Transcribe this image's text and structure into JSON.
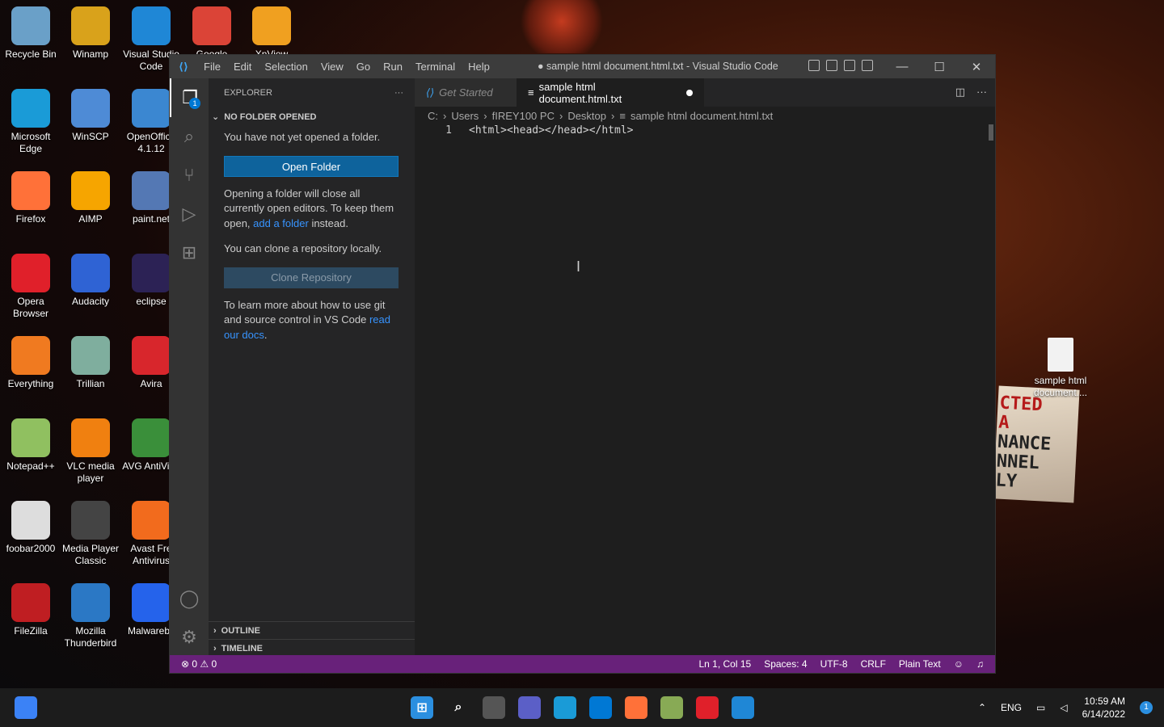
{
  "desktop": {
    "icons": [
      {
        "label": "Recycle Bin",
        "color": "#6aa0c8"
      },
      {
        "label": "Winamp",
        "color": "#d9a21b"
      },
      {
        "label": "Visual Studio Code",
        "color": "#1f87d6"
      },
      {
        "label": "Google",
        "color": "#db4437"
      },
      {
        "label": "XnView",
        "color": "#f0a020"
      },
      {
        "label": "Microsoft Edge",
        "color": "#1a9bd7"
      },
      {
        "label": "WinSCP",
        "color": "#4e8bd6"
      },
      {
        "label": "OpenOffice 4.1.12",
        "color": "#3b87d1"
      },
      {
        "label": "Firefox",
        "color": "#ff7139"
      },
      {
        "label": "AIMP",
        "color": "#f6a500"
      },
      {
        "label": "paint.net",
        "color": "#5478b4"
      },
      {
        "label": "Opera Browser",
        "color": "#e0202a"
      },
      {
        "label": "Audacity",
        "color": "#2f63d4"
      },
      {
        "label": "eclipse",
        "color": "#2c2255"
      },
      {
        "label": "Everything",
        "color": "#f07a20"
      },
      {
        "label": "Trillian",
        "color": "#7fae9e"
      },
      {
        "label": "Avira",
        "color": "#d8262c"
      },
      {
        "label": "Notepad++",
        "color": "#90c060"
      },
      {
        "label": "VLC media player",
        "color": "#f08010"
      },
      {
        "label": "AVG AntiVir...",
        "color": "#3a8f3a"
      },
      {
        "label": "foobar2000",
        "color": "#dddddd"
      },
      {
        "label": "Media Player Classic",
        "color": "#444444"
      },
      {
        "label": "Avast Fre Antivirus",
        "color": "#f26b1d"
      },
      {
        "label": "FileZilla",
        "color": "#bf1e22"
      },
      {
        "label": "Mozilla Thunderbird",
        "color": "#2b78c5"
      },
      {
        "label": "Malwareby",
        "color": "#2563eb"
      }
    ],
    "file_icon": {
      "label": "sample html document...."
    },
    "sign_lines": [
      "CTED",
      "A",
      "NANCE",
      "NNEL",
      "LY"
    ]
  },
  "window": {
    "title": "● sample html document.html.txt - Visual Studio Code",
    "menu": [
      "File",
      "Edit",
      "Selection",
      "View",
      "Go",
      "Run",
      "Terminal",
      "Help"
    ],
    "controls": {
      "minimize": "—",
      "maximize": "☐",
      "close": "✕"
    }
  },
  "activity_bar": {
    "explorer_badge": "1"
  },
  "sidebar": {
    "header": "EXPLORER",
    "more": "···",
    "section": "NO FOLDER OPENED",
    "text1": "You have not yet opened a folder.",
    "open_folder": "Open Folder",
    "text2_a": "Opening a folder will close all currently open editors. To keep them open, ",
    "text2_link": "add a folder",
    "text2_b": " instead.",
    "text3": "You can clone a repository locally.",
    "clone": "Clone Repository",
    "text4_a": "To learn more about how to use git and source control in VS Code ",
    "text4_link": "read our docs",
    "text4_b": ".",
    "outline": "OUTLINE",
    "timeline": "TIMELINE"
  },
  "editor": {
    "tabs": [
      {
        "label": "Get Started",
        "active": false
      },
      {
        "label": "sample html document.html.txt",
        "active": true
      }
    ],
    "breadcrumb": [
      "C:",
      "Users",
      "fIREY100 PC",
      "Desktop",
      "sample html document.html.txt"
    ],
    "lines": [
      {
        "num": "1",
        "text": "<html><head></head></html>"
      }
    ]
  },
  "status": {
    "problems": "⊗ 0 ⚠ 0",
    "position": "Ln 1, Col 15",
    "spaces": "Spaces: 4",
    "encoding": "UTF-8",
    "eol": "CRLF",
    "language": "Plain Text"
  },
  "taskbar": {
    "lang": "ENG",
    "time": "10:59 AM",
    "date": "6/14/2022",
    "notif": "1"
  }
}
